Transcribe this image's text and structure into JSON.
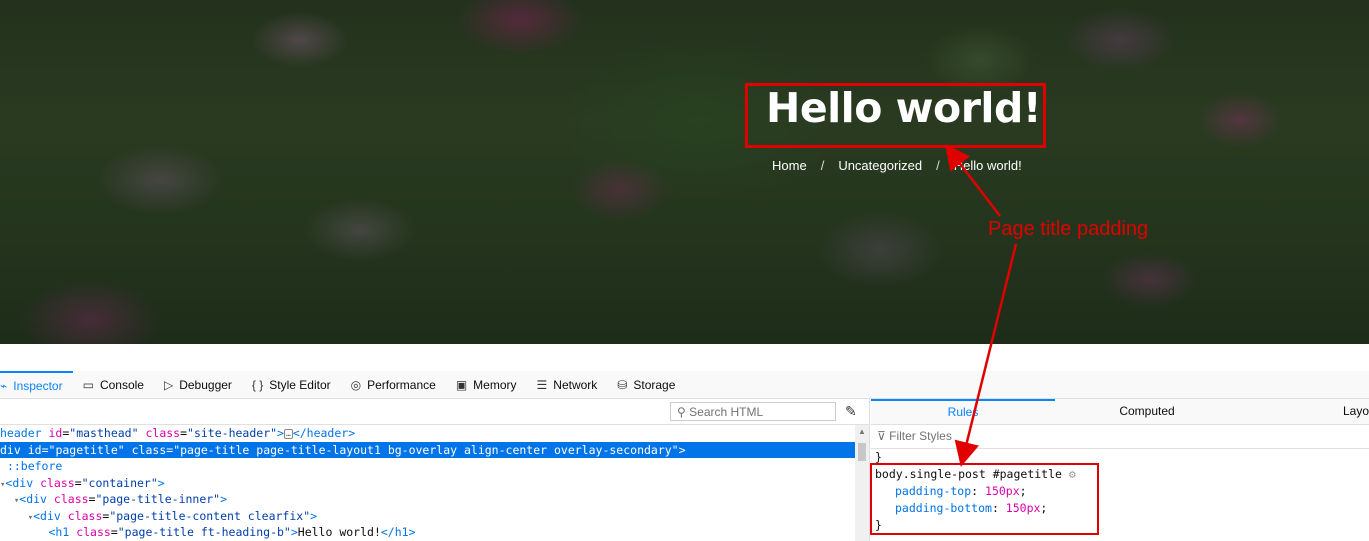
{
  "hero": {
    "title": "Hello world!",
    "breadcrumb": {
      "home": "Home",
      "category": "Uncategorized",
      "current": "Hello world!",
      "separator": "/"
    },
    "annotation": "Page title padding"
  },
  "devtools": {
    "tabs": {
      "inspector": "Inspector",
      "console": "Console",
      "debugger": "Debugger",
      "style_editor": "Style Editor",
      "performance": "Performance",
      "memory": "Memory",
      "network": "Network",
      "storage": "Storage"
    },
    "search_placeholder": "Search HTML",
    "markup": {
      "header_tag": "header",
      "header_attrs": "id=\"masthead\" class=\"site-header\"",
      "header_id_attr": "id",
      "header_id_val": "\"masthead\"",
      "header_class_attr": "class",
      "header_class_val": "\"site-header\"",
      "header_close": "</header>",
      "div_id_attr": "id",
      "div_id_val": "\"pagetitle\"",
      "div_class_attr": "class",
      "div_class_val": "\"page-title page-title-layout1 bg-overlay align-center overlay-secondary\"",
      "before": "::before",
      "container_class_val": "\"container\"",
      "inner_class_val": "\"page-title-inner\"",
      "content_class_val": "\"page-title-content clearfix\"",
      "h1_class_val": "\"page-title ft-heading-b\"",
      "h1_text": "Hello world!",
      "h1_close": "</h1>"
    },
    "rules_pane": {
      "tabs": {
        "rules": "Rules",
        "computed": "Computed",
        "layout": "Layo"
      },
      "filter_placeholder": "Filter Styles",
      "prev_close": "}",
      "selector": "body.single-post #pagetitle",
      "declarations": [
        {
          "property": "padding-top",
          "value": "150px"
        },
        {
          "property": "padding-bottom",
          "value": "150px"
        }
      ],
      "close": "}"
    }
  },
  "colors": {
    "annotation_red": "#e00000",
    "selection_blue": "#0074e8",
    "active_tab_blue": "#0a84ff"
  }
}
